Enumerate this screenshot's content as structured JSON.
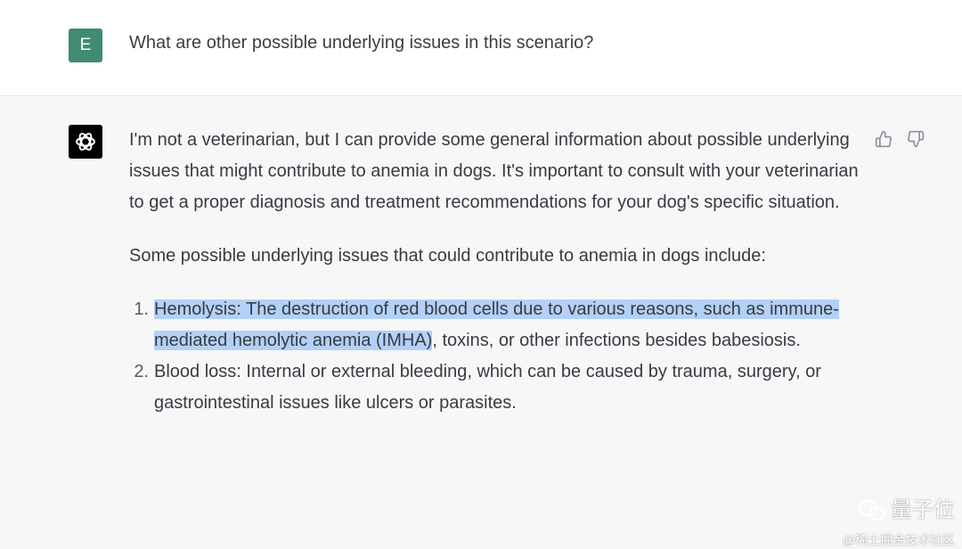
{
  "user_message": {
    "avatar_letter": "E",
    "text": "What are other possible underlying issues in this scenario?"
  },
  "assistant_message": {
    "intro": "I'm not a veterinarian, but I can provide some general information about possible underlying issues that might contribute to anemia in dogs. It's important to consult with your veterinarian to get a proper diagnosis and treatment recommendations for your dog's specific situation.",
    "lead": "Some possible underlying issues that could contribute to anemia in dogs include:",
    "items": [
      {
        "number": "1.",
        "highlighted": "Hemolysis: The destruction of red blood cells due to various reasons, such as immune-mediated hemolytic anemia (IMHA)",
        "rest": ", toxins, or other infections besides babesiosis."
      },
      {
        "number": "2.",
        "text": "Blood loss: Internal or external bleeding, which can be caused by trauma, surgery, or gastrointestinal issues like ulcers or parasites."
      }
    ]
  },
  "watermark": {
    "brand": "量子位",
    "sub": "@稀土掘金技术社区"
  },
  "colors": {
    "user_avatar": "#3f8b73",
    "assistant_bg": "#f7f7f8",
    "highlight": "#b3d1f6"
  },
  "icons": [
    "openai-logo-icon",
    "thumbs-up-icon",
    "thumbs-down-icon",
    "wechat-icon"
  ]
}
